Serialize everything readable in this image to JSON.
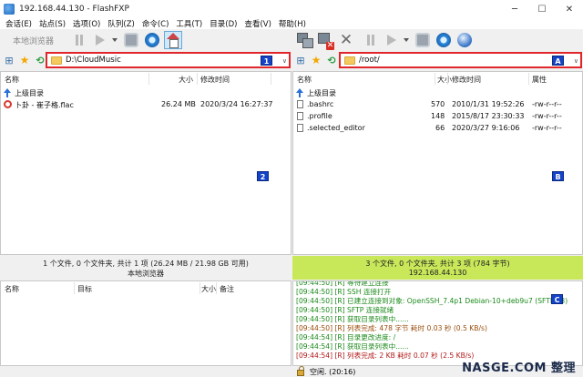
{
  "window": {
    "title": "192.168.44.130 - FlashFXP",
    "controls": [
      "─",
      "☐",
      "✕"
    ]
  },
  "menu": [
    "会话(E)",
    "站点(S)",
    "选项(O)",
    "队列(Z)",
    "命令(C)",
    "工具(T)",
    "目录(D)",
    "查看(V)",
    "帮助(H)"
  ],
  "local": {
    "toolbar_label": "本地浏览器",
    "path": "D:\\CloudMusic",
    "path_badge": "1",
    "pane_badge": "2",
    "columns": {
      "name": "名称",
      "size": "大小",
      "modified": "修改时间"
    },
    "parent_dir": "上级目录",
    "files": [
      {
        "name": "卜卦 - 崔子格.flac",
        "size": "26.24 MB",
        "modified": "2020/3/24 16:27:37"
      }
    ],
    "status_line1": "1 个文件, 0 个文件夹, 共计 1 项 (26.24 MB / 21.98 GB 可用)",
    "status_line2": "本地浏览器"
  },
  "remote": {
    "path": "/root/",
    "path_badge": "A",
    "pane_badge": "B",
    "columns": {
      "name": "名称",
      "size": "大小",
      "modified": "修改时间",
      "attr": "属性"
    },
    "parent_dir": "上级目录",
    "files": [
      {
        "name": ".bashrc",
        "size": "570",
        "modified": "2010/1/31 19:52:26",
        "attr": "-rw-r--r--"
      },
      {
        "name": ".profile",
        "size": "148",
        "modified": "2015/8/17 23:30:33",
        "attr": "-rw-r--r--"
      },
      {
        "name": ".selected_editor",
        "size": "66",
        "modified": "2020/3/27 9:16:06",
        "attr": "-rw-r--r--"
      }
    ],
    "status_line1": "3 个文件, 0 个文件夹, 共计 3 项 (784 字节)",
    "status_line2": "192.168.44.130",
    "status_color": "#c8e85a"
  },
  "queue": {
    "columns": {
      "name": "名称",
      "target": "目标",
      "size": "大小",
      "note": "备注"
    }
  },
  "log": {
    "badge": "C",
    "lines": [
      {
        "text": "[09:44:50] [R] 等待建立连接",
        "color": "green"
      },
      {
        "text": "[09:44:50] [R] SSH 连接打开",
        "color": "green"
      },
      {
        "text": "[09:44:50] [R] 已建立连接到对象: OpenSSH_7.4p1 Debian-10+deb9u7 (SFTP v3)",
        "color": "green"
      },
      {
        "text": "[09:44:50] [R] SFTP 连接就绪",
        "color": "green"
      },
      {
        "text": "[09:44:50] [R] 获取目录列表中......",
        "color": "green"
      },
      {
        "text": "[09:44:50] [R] 列表完成: 478 字节 耗时 0.03 秒 (0.5 KB/s)",
        "color": "brown"
      },
      {
        "text": "[09:44:54] [R] 目录更改进度: /",
        "color": "green"
      },
      {
        "text": "[09:44:54] [R] 获取目录列表中......",
        "color": "green"
      },
      {
        "text": "[09:44:54] [R] 列表完成: 2 KB 耗时 0.07 秒 (2.5 KB/s)",
        "color": "red"
      }
    ],
    "status": "空闲. (20:16)"
  },
  "watermark": "NASGE.COM 整理",
  "accent": {
    "badge_blue": "#1443c8",
    "path_border": "#e0262b"
  }
}
